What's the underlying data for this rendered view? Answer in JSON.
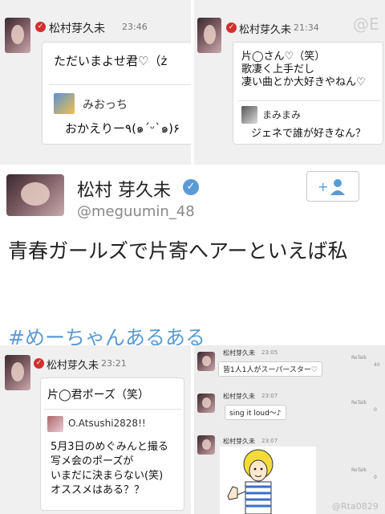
{
  "panel_top_left": {
    "name": "松村芽久未",
    "time": "23:46",
    "message": "ただいまよせ君♡（ż",
    "reply_name": "みおっち",
    "reply_text": "おかえりー٩(๑ˊᵕˋ๑)۶"
  },
  "panel_top_right": {
    "name": "松村芽久未",
    "time": "21:34",
    "message_lines": [
      "片◯さん♡（笑）",
      "歌凄く上手だし",
      "凄い曲とか大好きやねん♡"
    ],
    "reply_name": "まみまみ",
    "reply_text": "ジェネで誰が好きなん？",
    "watermark": "@E"
  },
  "tweet": {
    "display_name": "松村 芽久未",
    "handle": "@meguumin_48",
    "follow_icon": "follow-person-plus-icon",
    "verified_icon": "verified-check-icon",
    "body": "青春ガールズで片寄へアーといえば私",
    "hashtag": "#めーちゃんあるある"
  },
  "panel_bottom_left": {
    "name": "松村芽久未",
    "time": "23:21",
    "message": "片◯君ポーズ（笑）",
    "reply_name": "O.Atsushi2828!!",
    "reply_lines": [
      "5月3日のめぐみんと撮る",
      "写メ会のポーズが",
      "いまだに決まらない(笑)",
      "オススメはある？？"
    ]
  },
  "panel_bottom_right": {
    "posts": [
      {
        "name": "松村芽久未",
        "time": "23:05",
        "message": "皆1人1人がスーパースター♡",
        "retalk": "ReTalk",
        "count": "40"
      },
      {
        "name": "松村芽久未",
        "time": "23:07",
        "message": "sing it loud〜♪",
        "retalk": "ReTalk",
        "count": "0"
      },
      {
        "name": "松村芽久未",
        "time": "23:07",
        "message": "",
        "retalk": "ReTalk",
        "count": "0"
      }
    ],
    "watermark": "@Rta0829"
  },
  "colors": {
    "verified_red": "#d32f2f",
    "twitter_blue": "#5b9bd5",
    "panel_bg": "#f0f0f0"
  }
}
